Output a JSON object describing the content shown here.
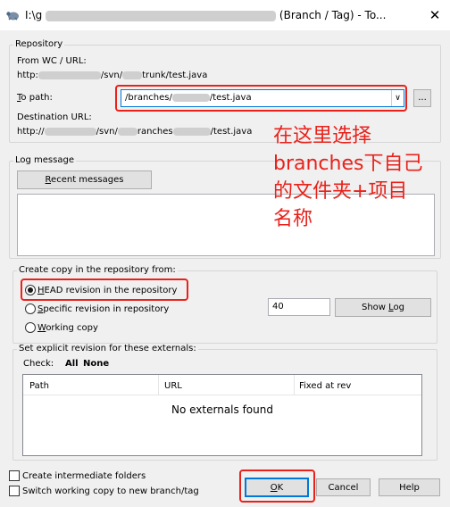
{
  "window": {
    "title_prefix": "I:\\g",
    "title_suffix": "(Branch / Tag) - To...",
    "close_glyph": "✕",
    "icon": "tortoise-svn-icon"
  },
  "repository": {
    "group_label": "Repository",
    "from_label": "From WC / URL:",
    "from_parts": [
      "http:",
      "/svn/",
      "trunk/test.java"
    ],
    "to_label": "To path:",
    "to_value_parts": [
      "/branches/",
      "/test.java"
    ],
    "dropdown_glyph": "∨",
    "browse_label": "...",
    "destination_label": "Destination URL:",
    "destination_parts": [
      "http://",
      "/svn/",
      "ranches",
      "/test.java"
    ]
  },
  "annotation": {
    "lines": [
      "在这里选择",
      "branches下自己",
      "的文件夹+项目",
      "名称"
    ]
  },
  "log": {
    "group_label": "Log message",
    "recent_button": "Recent messages",
    "message": ""
  },
  "copy_from": {
    "group_label": "Create copy in the repository from:",
    "head_option": "HEAD revision in the repository",
    "specific_option": "Specific revision in repository",
    "working_option": "Working copy",
    "revision_value": "40",
    "show_log_button": "Show Log"
  },
  "externals": {
    "group_label": "Set explicit revision for these externals:",
    "check_label": "Check:",
    "check_all": "All",
    "check_none": "None",
    "columns": [
      "Path",
      "URL",
      "Fixed at rev"
    ],
    "empty_message": "No externals found"
  },
  "options": {
    "intermediate_folders": "Create intermediate folders",
    "switch_working_copy": "Switch working copy to new branch/tag"
  },
  "buttons": {
    "ok": "OK",
    "cancel": "Cancel",
    "help": "Help"
  },
  "colors": {
    "annotation_red": "#e8221b",
    "selection_blue": "#0078d7",
    "window_bg": "#f0f0f0"
  }
}
